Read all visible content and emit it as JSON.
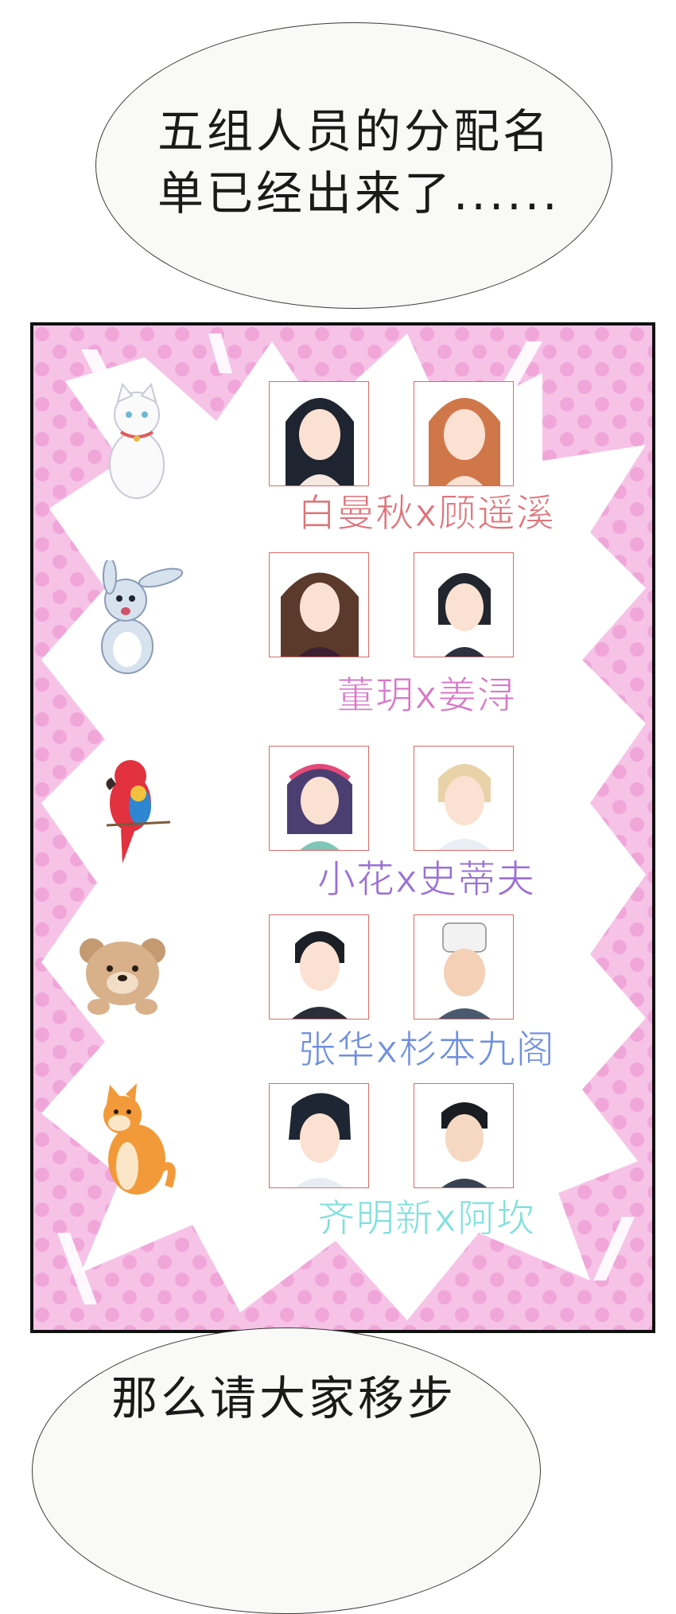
{
  "top_bubble": {
    "line1": "五组人员的分配名",
    "line2": "单已经出来了......"
  },
  "bottom_bubble": {
    "line1": "那么请大家移步"
  },
  "groups": [
    {
      "animal": "cat-icon",
      "label": "白曼秋x顾遥溪",
      "color": "#e0737a"
    },
    {
      "animal": "rabbit-icon",
      "label": "董玥x姜浔",
      "color": "#d877c8"
    },
    {
      "animal": "parrot-icon",
      "label": "小花x史蒂夫",
      "color": "#9b6fd6"
    },
    {
      "animal": "bear-icon",
      "label": "张华x杉本九阁",
      "color": "#6f8fe0"
    },
    {
      "animal": "shiba-dog-icon",
      "label": "齐明新x阿坎",
      "color": "#7fe0dc"
    }
  ]
}
